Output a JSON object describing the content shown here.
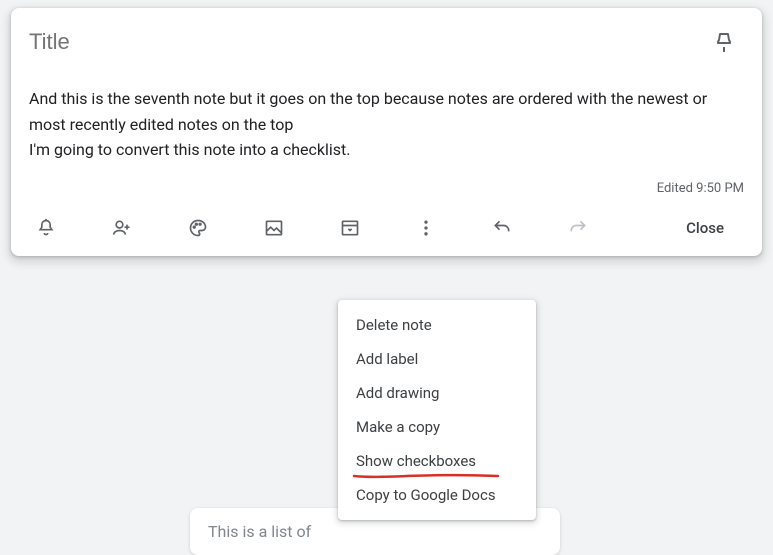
{
  "note": {
    "title_placeholder": "Title",
    "body": "And this is the seventh note but it goes on the top because notes are ordered with the newest or most recently edited notes on the top\nI'm going to convert this note into a checklist.",
    "edited": "Edited 9:50 PM"
  },
  "toolbar": {
    "close": "Close"
  },
  "menu": {
    "items": [
      "Delete note",
      "Add label",
      "Add drawing",
      "Make a copy",
      "Show checkboxes",
      "Copy to Google Docs"
    ],
    "highlighted_index": 4
  },
  "background_note": {
    "text": "This is a list of"
  }
}
